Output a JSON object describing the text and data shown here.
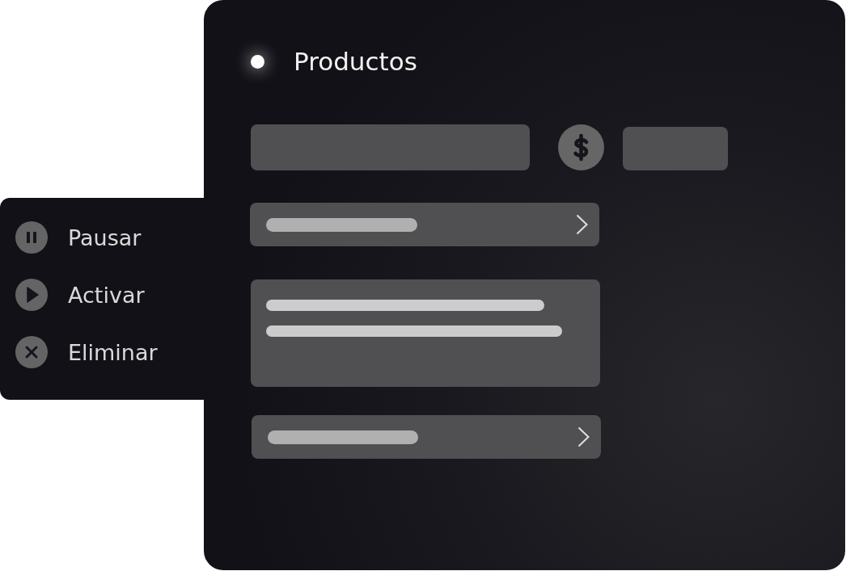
{
  "context_menu": {
    "items": [
      {
        "label": "Pausar",
        "kind": "pause"
      },
      {
        "label": "Activar",
        "kind": "play"
      },
      {
        "label": "Eliminar",
        "kind": "delete"
      }
    ]
  },
  "panel": {
    "title": "Productos"
  }
}
